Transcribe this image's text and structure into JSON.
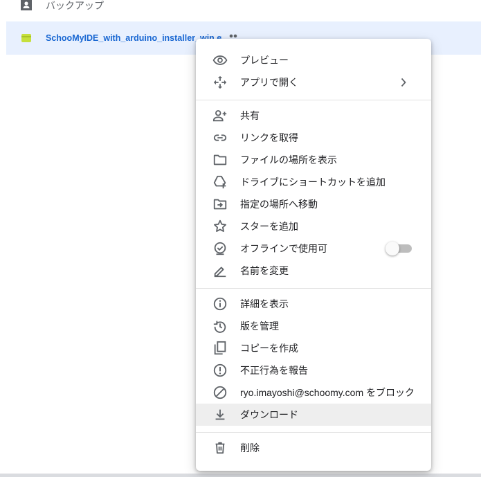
{
  "colors": {
    "accent": "#1967d2",
    "selected_row": "#e8f0fe",
    "icon": "#5f6368",
    "file_icon": "#c6e03d"
  },
  "list": {
    "backup_label": "バックアップ",
    "selected_file": {
      "name": "SchooMyIDE_with_arduino_installer_win.exe",
      "icon": "file-icon",
      "shared_icon": "people-icon"
    }
  },
  "menu": {
    "items": [
      {
        "label": "プレビュー",
        "icon": "eye-icon"
      },
      {
        "label": "アプリで開く",
        "icon": "move-arrows-icon",
        "has_submenu": true
      },
      {
        "label": "共有",
        "icon": "person-add-icon"
      },
      {
        "label": "リンクを取得",
        "icon": "link-icon"
      },
      {
        "label": "ファイルの場所を表示",
        "icon": "folder-icon"
      },
      {
        "label": "ドライブにショートカットを追加",
        "icon": "drive-shortcut-icon"
      },
      {
        "label": "指定の場所へ移動",
        "icon": "folder-move-icon"
      },
      {
        "label": "スターを追加",
        "icon": "star-icon"
      },
      {
        "label": "オフラインで使用可",
        "icon": "offline-check-icon",
        "toggle_on": false
      },
      {
        "label": "名前を変更",
        "icon": "pencil-icon"
      },
      {
        "label": "詳細を表示",
        "icon": "info-icon"
      },
      {
        "label": "版を管理",
        "icon": "history-icon"
      },
      {
        "label": "コピーを作成",
        "icon": "copy-icon"
      },
      {
        "label": "不正行為を報告",
        "icon": "report-icon"
      },
      {
        "label": "ryo.imayoshi@schoomy.com をブロック",
        "icon": "block-icon"
      },
      {
        "label": "ダウンロード",
        "icon": "download-icon",
        "highlighted": true
      },
      {
        "label": "削除",
        "icon": "trash-icon"
      }
    ]
  }
}
